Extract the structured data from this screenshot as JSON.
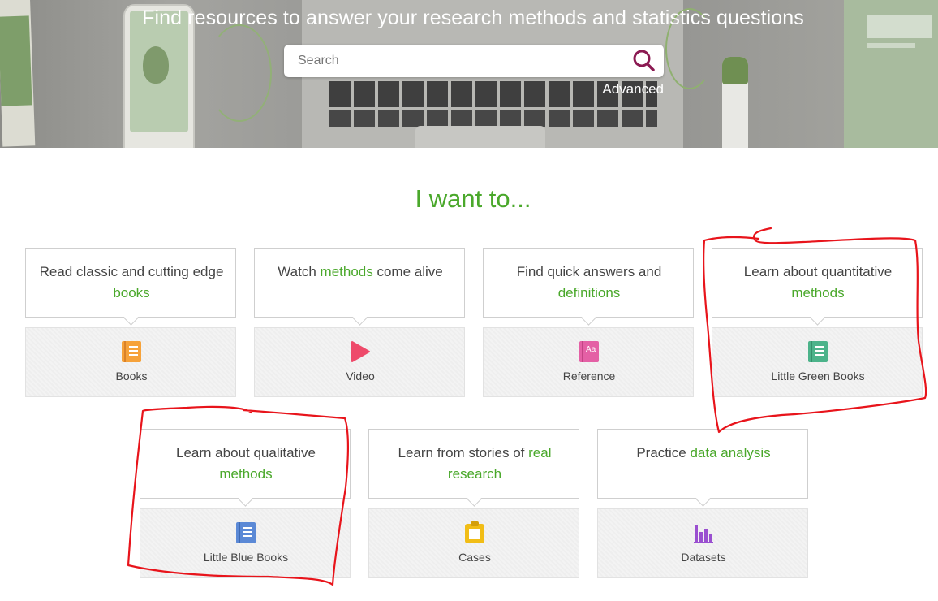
{
  "hero": {
    "title": "Find resources to answer your research methods and statistics questions",
    "search_placeholder": "Search",
    "advanced_label": "Advanced"
  },
  "heading": "I want to...",
  "colors": {
    "accent_green": "#4aa82b",
    "annotation_red": "#e8141b"
  },
  "cards": [
    {
      "caption_pre": "Read classic and cutting edge ",
      "caption_hl": "books",
      "caption_post": "",
      "tile_label": "Books",
      "icon": "book-icon",
      "icon_color": "#f6a23a"
    },
    {
      "caption_pre": "Watch ",
      "caption_hl": "methods",
      "caption_post": " come alive",
      "tile_label": "Video",
      "icon": "play-icon",
      "icon_color": "#ee4a6a"
    },
    {
      "caption_pre": "Find quick answers and ",
      "caption_hl": "definitions",
      "caption_post": "",
      "tile_label": "Reference",
      "icon": "reference-book-icon",
      "icon_color": "#e460a5"
    },
    {
      "caption_pre": "Learn about quantitative ",
      "caption_hl": "methods",
      "caption_post": "",
      "tile_label": "Little Green Books",
      "icon": "green-book-icon",
      "icon_color": "#4cb38a"
    },
    {
      "caption_pre": "Learn about qualitative ",
      "caption_hl": "methods",
      "caption_post": "",
      "tile_label": "Little Blue Books",
      "icon": "blue-book-icon",
      "icon_color": "#5b89d6"
    },
    {
      "caption_pre": "Learn from stories of ",
      "caption_hl": "real research",
      "caption_post": "",
      "tile_label": "Cases",
      "icon": "clipboard-icon",
      "icon_color": "#f1bd16"
    },
    {
      "caption_pre": "Practice ",
      "caption_hl": "data analysis",
      "caption_post": "",
      "tile_label": "Datasets",
      "icon": "bar-chart-icon",
      "icon_color": "#9a4fd0"
    }
  ]
}
